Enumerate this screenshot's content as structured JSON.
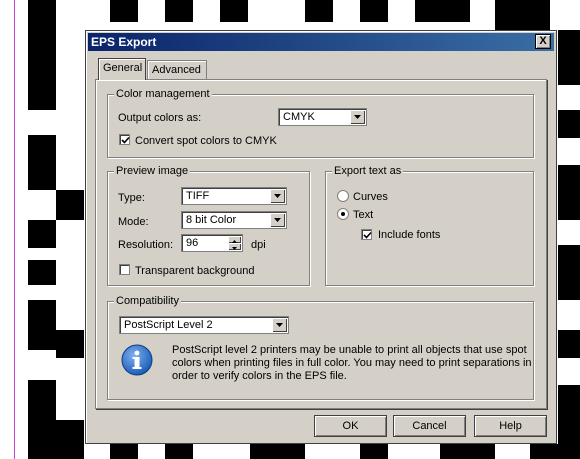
{
  "dialog": {
    "title": "EPS Export",
    "close_glyph": "X"
  },
  "tabs": [
    {
      "label": "General"
    },
    {
      "label": "Advanced"
    }
  ],
  "color_management": {
    "legend": "Color management",
    "output_colors_label": "Output colors as:",
    "output_colors_value": "CMYK",
    "convert_spot_label": "Convert spot colors to CMYK",
    "convert_spot_checked": true
  },
  "preview_image": {
    "legend": "Preview image",
    "type_label": "Type:",
    "type_value": "TIFF",
    "mode_label": "Mode:",
    "mode_value": "8 bit Color",
    "resolution_label": "Resolution:",
    "resolution_value": "96",
    "resolution_unit": "dpi",
    "transparent_label": "Transparent background",
    "transparent_checked": false
  },
  "export_text": {
    "legend": "Export text as",
    "curves_label": "Curves",
    "text_label": "Text",
    "selected": "Text",
    "include_fonts_label": "Include fonts",
    "include_fonts_checked": true
  },
  "compatibility": {
    "legend": "Compatibility",
    "value": "PostScript Level 2",
    "info_text": "PostScript level 2 printers may be unable to print all objects that use spot colors when printing files in full color. You may need to print separations in order to verify colors in the EPS file.",
    "info_icon": "info-icon"
  },
  "buttons": {
    "ok": "OK",
    "cancel": "Cancel",
    "help": "Help"
  },
  "colors": {
    "titlebar_start": "#0a246a",
    "titlebar_end": "#3a6ea5",
    "dialog_face": "#d4d0c8",
    "info_blue": "#1c5fb8"
  }
}
